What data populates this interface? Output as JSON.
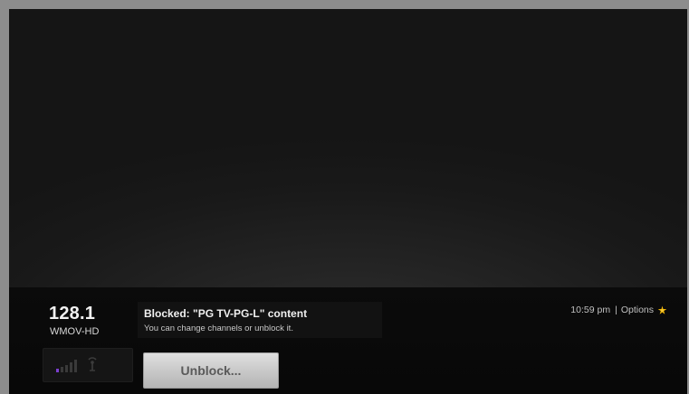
{
  "channel": {
    "number": "128.1",
    "name": "WMOV-HD"
  },
  "signal": {
    "icon": "signal-strength-icon",
    "antenna_icon": "antenna-icon"
  },
  "message": {
    "title": "Blocked: \"PG TV-PG-L\" content",
    "subtitle": "You can change channels or unblock it."
  },
  "actions": {
    "unblock_label": "Unblock..."
  },
  "status": {
    "time": "10:59 pm",
    "separator": "|",
    "options_label": "Options",
    "options_icon": "star-icon",
    "options_icon_color": "#f2b705"
  },
  "colors": {
    "signal_accent": "#7b3fd0",
    "options_star": "#f2b705"
  }
}
